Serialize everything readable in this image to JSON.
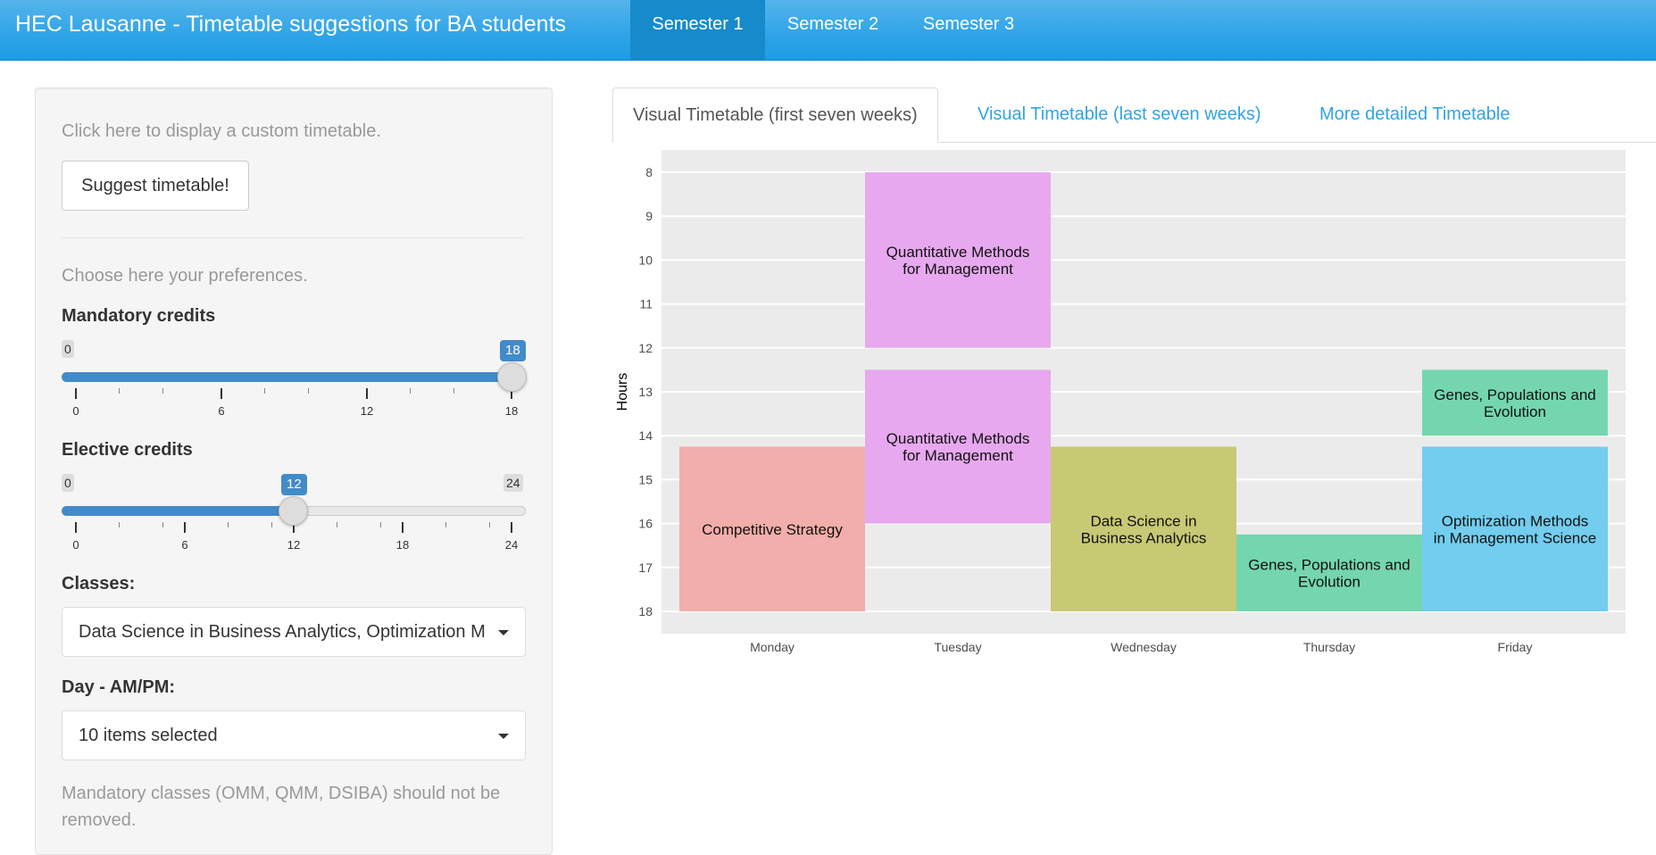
{
  "navbar": {
    "brand": "HEC Lausanne - Timetable suggestions for BA students",
    "tabs": [
      {
        "label": "Semester 1",
        "active": true
      },
      {
        "label": "Semester 2",
        "active": false
      },
      {
        "label": "Semester 3",
        "active": false
      }
    ]
  },
  "sidebar": {
    "custom_help": "Click here to display a custom timetable.",
    "suggest_button": "Suggest timetable!",
    "pref_help": "Choose here your preferences.",
    "mandatory": {
      "label": "Mandatory credits",
      "min": 0,
      "max": 18,
      "value": 18,
      "ticks": [
        "0",
        "6",
        "12",
        "18"
      ]
    },
    "elective": {
      "label": "Elective credits",
      "min": 0,
      "max": 24,
      "value": 12,
      "ticks": [
        "0",
        "6",
        "12",
        "18",
        "24"
      ]
    },
    "classes": {
      "label": "Classes:",
      "value": "Data Science in Business Analytics, Optimization M"
    },
    "day": {
      "label": "Day - AM/PM:",
      "value": "10 items selected"
    },
    "note": "Mandatory classes (OMM, QMM, DSIBA) should not be removed."
  },
  "tabs": [
    {
      "label": "Visual Timetable (first seven weeks)",
      "active": true
    },
    {
      "label": "Visual Timetable (last seven weeks)",
      "active": false
    },
    {
      "label": "More detailed Timetable",
      "active": false
    }
  ],
  "chart_data": {
    "type": "timetable",
    "xlabel": "",
    "ylabel": "Hours",
    "categories": [
      "Monday",
      "Tuesday",
      "Wednesday",
      "Thursday",
      "Friday"
    ],
    "ylim": [
      8,
      18
    ],
    "yticks": [
      8,
      9,
      10,
      11,
      12,
      13,
      14,
      15,
      16,
      17,
      18
    ],
    "blocks": [
      {
        "day": "Monday",
        "start": 14.25,
        "end": 18,
        "label": "Competitive Strategy",
        "color": "#f1aeaa"
      },
      {
        "day": "Tuesday",
        "start": 8,
        "end": 12,
        "label": "Quantitative Methods for Management",
        "color": "#e7a8ef"
      },
      {
        "day": "Tuesday",
        "start": 12.5,
        "end": 16,
        "label": "Quantitative Methods for Management",
        "color": "#e7a8ef"
      },
      {
        "day": "Wednesday",
        "start": 14.25,
        "end": 18,
        "label": "Data Science in Business Analytics",
        "color": "#c8c974"
      },
      {
        "day": "Thursday",
        "start": 16.25,
        "end": 18,
        "label": "Genes, Populations and Evolution",
        "color": "#74d6af"
      },
      {
        "day": "Friday",
        "start": 12.5,
        "end": 14,
        "label": "Genes, Populations and Evolution",
        "color": "#74d6af"
      },
      {
        "day": "Friday",
        "start": 14.25,
        "end": 18,
        "label": "Optimization Methods in Management Science",
        "color": "#72cdef"
      }
    ]
  }
}
